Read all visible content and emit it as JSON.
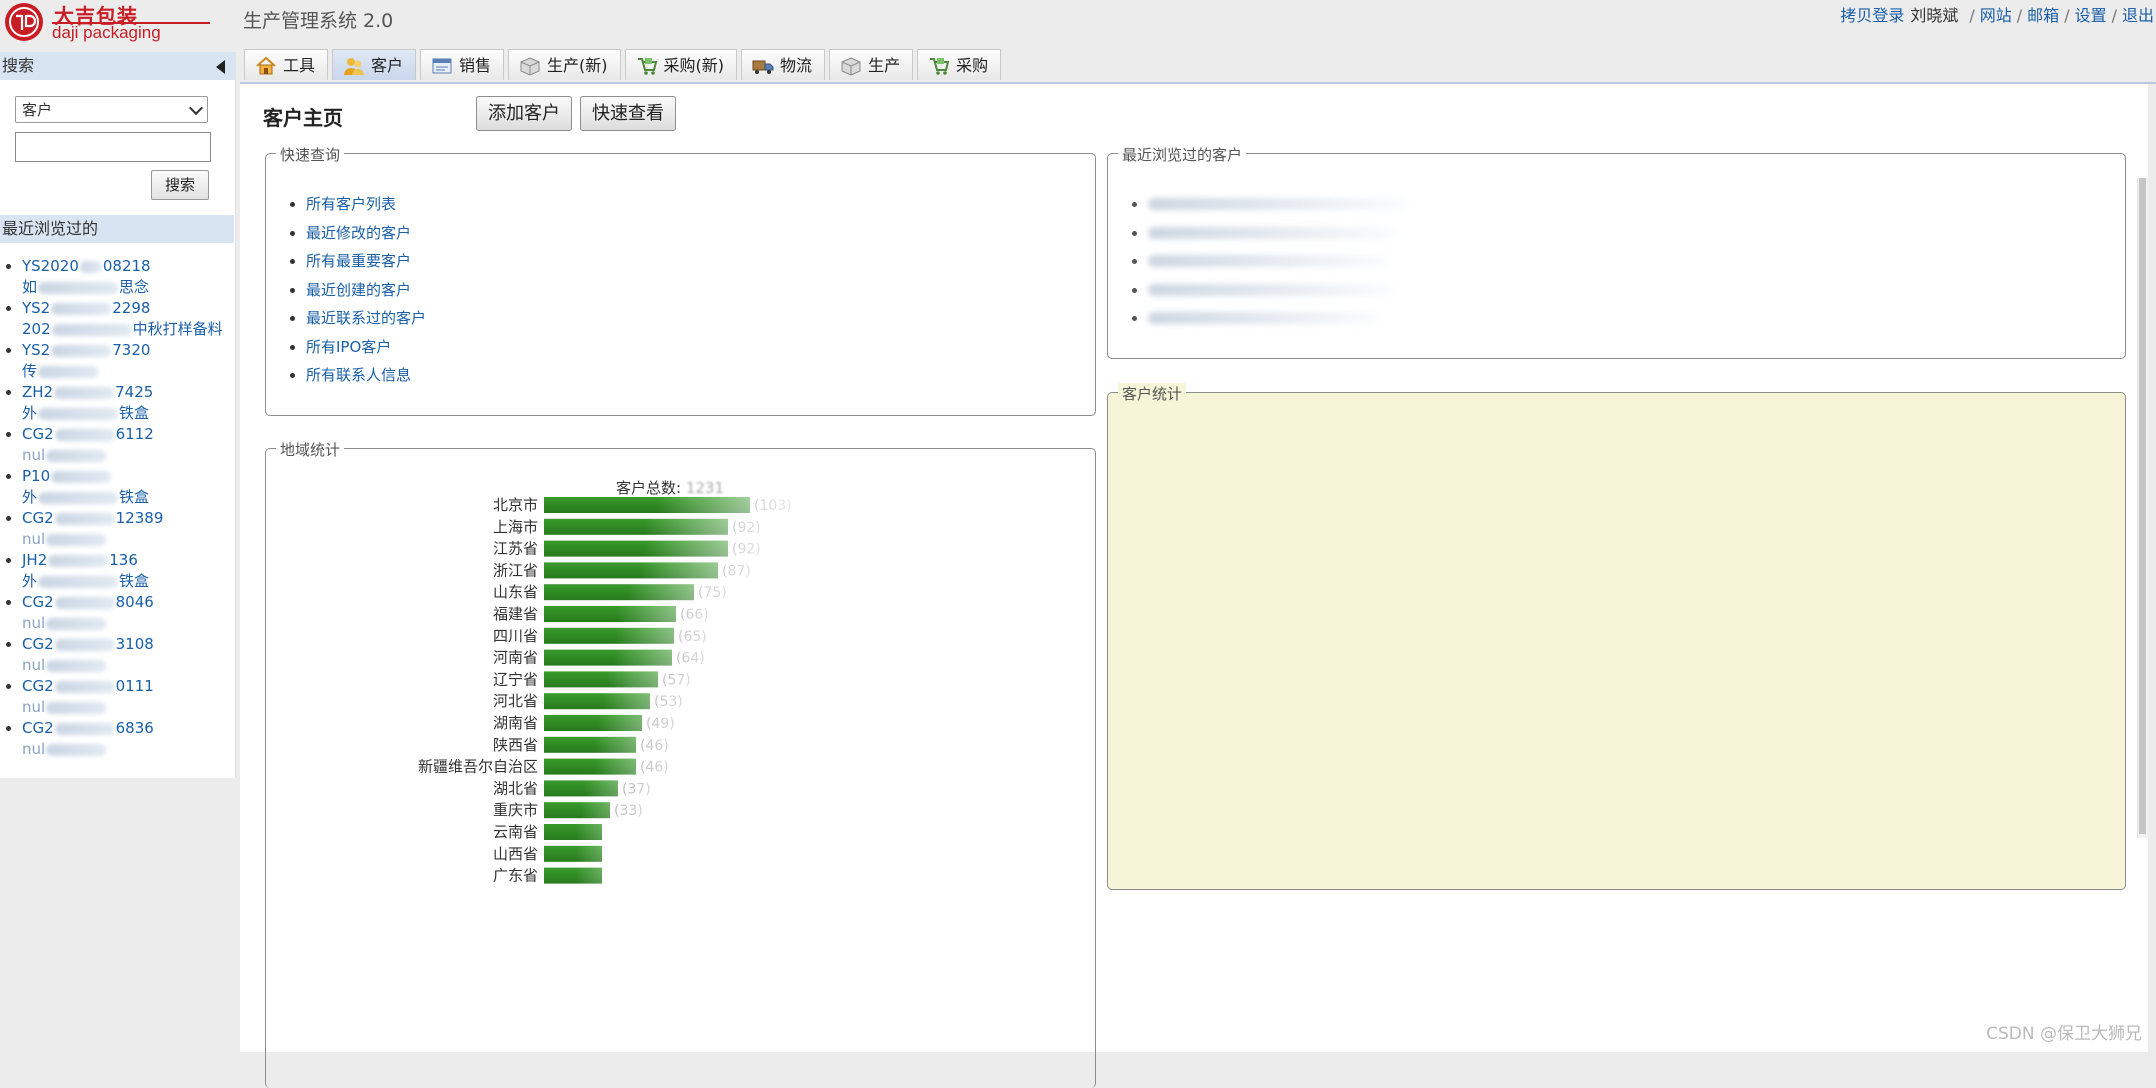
{
  "header": {
    "logo_cn": "大吉包装",
    "logo_en": "daji packaging",
    "app_title": "生产管理系统 2.0",
    "links": {
      "impersonate": "拷贝登录",
      "user": "刘晓斌",
      "website": "网站",
      "mail": "邮箱",
      "settings": "设置",
      "logout": "退出"
    }
  },
  "sidebar": {
    "search_title": "搜索",
    "type_select": "客户",
    "search_button": "搜索",
    "recent_title": "最近浏览过的",
    "recent_items": [
      {
        "code": "YS2020",
        "code_tail": "08218",
        "desc": "如",
        "desc_tail": "思念"
      },
      {
        "code": "YS2",
        "code_tail": "2298",
        "desc": "202",
        "desc_tail": "中秋打样备料"
      },
      {
        "code": "YS2",
        "code_tail": "7320",
        "desc": "传",
        "desc_tail": ""
      },
      {
        "code": "ZH2",
        "code_tail": "7425",
        "desc": "外",
        "desc_tail": "铁盒"
      },
      {
        "code": "CG2",
        "code_tail": "6112",
        "desc": "nul",
        "desc_tail": ""
      },
      {
        "code": "P10",
        "code_tail": "",
        "desc": "外",
        "desc_tail": "铁盒"
      },
      {
        "code": "CG2",
        "code_tail": "12389",
        "desc": "nul",
        "desc_tail": ""
      },
      {
        "code": "JH2",
        "code_tail": "136",
        "desc": "外",
        "desc_tail": "铁盒"
      },
      {
        "code": "CG2",
        "code_tail": "8046",
        "desc": "nul",
        "desc_tail": ""
      },
      {
        "code": "CG2",
        "code_tail": "3108",
        "desc": "nul",
        "desc_tail": ""
      },
      {
        "code": "CG2",
        "code_tail": "0111",
        "desc": "nul",
        "desc_tail": ""
      },
      {
        "code": "CG2",
        "code_tail": "6836",
        "desc": "nul",
        "desc_tail": ""
      }
    ]
  },
  "tabs": [
    {
      "label": "工具",
      "icon": "home-icon",
      "active": false
    },
    {
      "label": "客户",
      "icon": "customer-icon",
      "active": true
    },
    {
      "label": "销售",
      "icon": "sales-icon",
      "active": false
    },
    {
      "label": "生产(新)",
      "icon": "box-icon",
      "active": false
    },
    {
      "label": "采购(新)",
      "icon": "purchase-icon",
      "active": false
    },
    {
      "label": "物流",
      "icon": "truck-icon",
      "active": false
    },
    {
      "label": "生产",
      "icon": "box-icon",
      "active": false
    },
    {
      "label": "采购",
      "icon": "purchase-icon",
      "active": false
    }
  ],
  "main": {
    "title": "客户主页",
    "add_button": "添加客户",
    "quick_view_button": "快速查看",
    "quick_query": {
      "legend": "快速查询",
      "links": [
        "所有客户列表",
        "最近修改的客户",
        "所有最重要客户",
        "最近创建的客户",
        "最近联系过的客户",
        "所有IPO客户",
        "所有联系人信息"
      ]
    },
    "recently_viewed": {
      "legend": "最近浏览过的客户"
    },
    "stats": {
      "legend": "客户统计"
    },
    "region": {
      "legend": "地域统计",
      "total_label": "客户总数:",
      "total_value": "1231"
    }
  },
  "chart_data": {
    "type": "bar",
    "orientation": "horizontal",
    "categories": [
      "北京市",
      "上海市",
      "江苏省",
      "浙江省",
      "山东省",
      "福建省",
      "四川省",
      "河南省",
      "辽宁省",
      "河北省",
      "湖南省",
      "陕西省",
      "新疆维吾尔自治区",
      "湖北省",
      "重庆市",
      "云南省",
      "山西省",
      "广东省"
    ],
    "values": [
      103,
      92,
      92,
      87,
      75,
      66,
      65,
      64,
      57,
      53,
      49,
      46,
      46,
      37,
      33,
      29,
      29,
      29
    ],
    "value_labels": [
      "(103)",
      "(92)",
      "(92)",
      "(87)",
      "(75)",
      "(66)",
      "(65)",
      "(64)",
      "(57)",
      "(53)",
      "(49)",
      "(46)",
      "(46)",
      "(37)",
      "(33)",
      "",
      "",
      ""
    ],
    "color": "#2e8b22",
    "title": "",
    "xlabel": "",
    "ylabel": ""
  },
  "watermark": "CSDN @保卫大狮兄"
}
